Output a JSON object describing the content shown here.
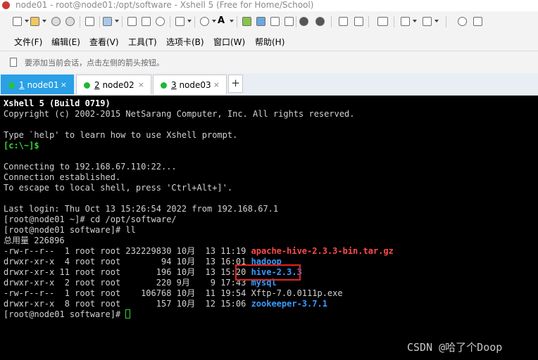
{
  "window": {
    "title": "node01 - root@node01:/opt/software - Xshell 5 (Free for Home/School)"
  },
  "toolbar": {
    "icons": [
      "new-session-icon",
      "open-folder-icon",
      "reconnect-icon",
      "disconnect-icon",
      "properties-icon",
      "copy-icon",
      "paste-icon",
      "find-icon",
      "print-icon",
      "font-icon",
      "color-scheme-icon",
      "xftp-icon",
      "xmanager-icon",
      "fullscreen-icon",
      "lock-icon",
      "keyboard-icon",
      "add-icon",
      "help-icon",
      "chat-icon"
    ]
  },
  "menu": {
    "items": [
      "文件(F)",
      "编辑(E)",
      "查看(V)",
      "工具(T)",
      "选项卡(B)",
      "窗口(W)",
      "帮助(H)"
    ]
  },
  "hint": {
    "text": "要添加当前会话，点击左侧的箭头按钮。"
  },
  "tabs": [
    {
      "num": "1",
      "name": " node01",
      "close": "×"
    },
    {
      "num": "2",
      "name": " node02",
      "close": "×"
    },
    {
      "num": "3",
      "name": " node03",
      "close": "×"
    }
  ],
  "tab_add": "+",
  "terminal": {
    "banner": "Xshell 5 (Build 0719)",
    "copyright": "Copyright (c) 2002-2015 NetSarang Computer, Inc. All rights reserved.",
    "help": "Type `help' to learn how to use Xshell prompt.",
    "local_prompt": "[c:\\~]$",
    "connecting": "Connecting to 192.168.67.110:22...",
    "established": "Connection established.",
    "escape": "To escape to local shell, press 'Ctrl+Alt+]'.",
    "last_login": "Last login: Thu Oct 13 15:26:54 2022 from 192.168.67.1",
    "cmd1": "[root@node01 ~]# cd /opt/software/",
    "cmd2": "[root@node01 software]# ll",
    "total": "总用量 226896",
    "files": [
      {
        "info": "-rw-r--r--  1 root root 232229830 10月  13 11:19 ",
        "name": "apache-hive-2.3.3-bin.tar.gz",
        "color": "red"
      },
      {
        "info": "drwxr-xr-x  4 root root        94 10月  13 16:01 ",
        "name": "hadoop",
        "color": "blue"
      },
      {
        "info": "drwxr-xr-x 11 root root       196 10月  13 15:20 ",
        "name": "hive-2.3.3",
        "color": "blue"
      },
      {
        "info": "drwxr-xr-x  2 root root       220 9月    9 17:43 ",
        "name": "mysql",
        "color": "blue"
      },
      {
        "info": "-rw-r--r--  1 root root    106768 10月  11 19:54 ",
        "name": "Xftp-7.0.0111p.exe",
        "color": "plain"
      },
      {
        "info": "drwxr-xr-x  8 root root       157 10月  12 15:06 ",
        "name": "zookeeper-3.7.1",
        "color": "blue"
      }
    ],
    "final_prompt": "[root@node01 software]# "
  },
  "watermark": "CSDN @哈了个Doop"
}
